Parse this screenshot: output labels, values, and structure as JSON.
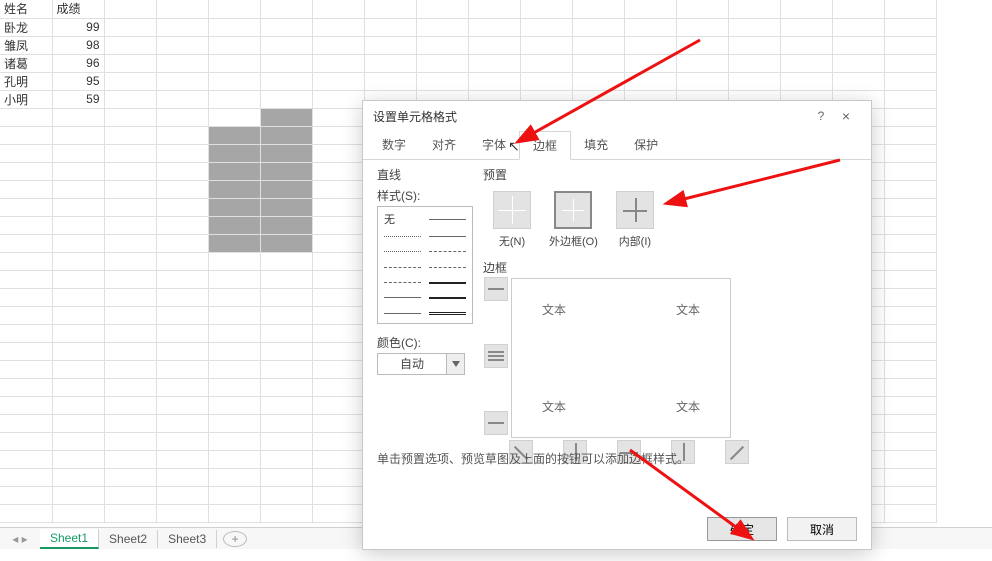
{
  "dialog": {
    "title": "设置单元格格式",
    "help": "?",
    "close": "×",
    "tabs": {
      "number": "数字",
      "align": "对齐",
      "font": "字体",
      "border": "边框",
      "fill": "填充",
      "protect": "保护"
    },
    "line_group": "直线",
    "style_label": "样式(S):",
    "style_none": "无",
    "color_label": "颜色(C):",
    "color_value": "自动",
    "presets_group": "预置",
    "preset_none": "无(N)",
    "preset_outer": "外边框(O)",
    "preset_inner": "内部(I)",
    "border_group": "边框",
    "preview_text": "文本",
    "hint": "单击预置选项、预览草图及上面的按钮可以添加边框样式。",
    "ok": "确定",
    "cancel": "取消"
  },
  "sheet": {
    "headers": {
      "name": "姓名",
      "score": "成绩"
    },
    "rows": [
      {
        "name": "卧龙",
        "score": "99"
      },
      {
        "name": "雏凤",
        "score": "98"
      },
      {
        "name": "诸葛",
        "score": "96"
      },
      {
        "name": "孔明",
        "score": "95"
      },
      {
        "name": "小明",
        "score": "59"
      }
    ]
  },
  "tabs": {
    "s1": "Sheet1",
    "s2": "Sheet2",
    "s3": "Sheet3",
    "add": "+"
  }
}
